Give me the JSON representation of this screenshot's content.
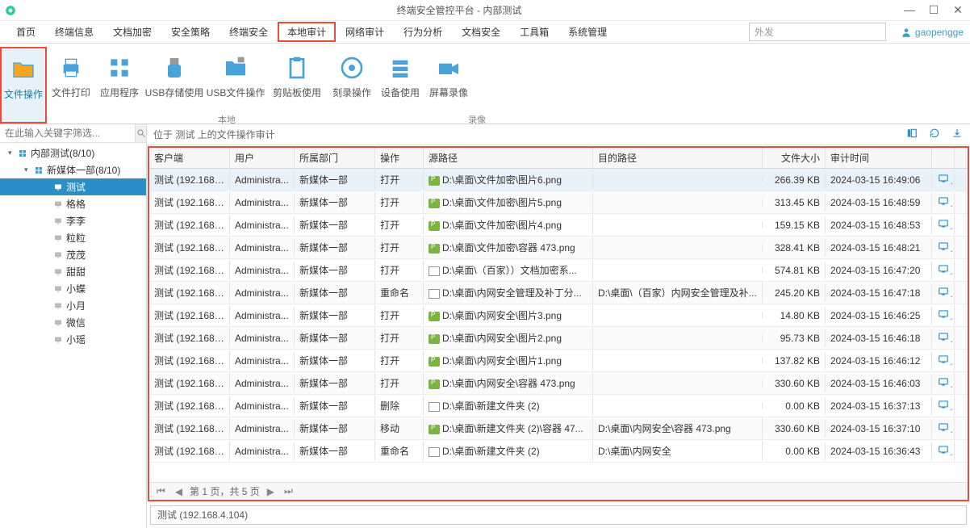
{
  "window": {
    "title": "终端安全管控平台 - 内部测试"
  },
  "menu": {
    "items": [
      "首页",
      "终端信息",
      "文档加密",
      "安全策略",
      "终端安全",
      "本地审计",
      "网络审计",
      "行为分析",
      "文档安全",
      "工具箱",
      "系统管理"
    ],
    "active_index": 5,
    "search_placeholder": "外发",
    "user": "gaopengge"
  },
  "ribbon": {
    "items": [
      {
        "label": "文件操作",
        "icon": "folder",
        "highlight": true
      },
      {
        "label": "文件打印",
        "icon": "printer"
      },
      {
        "label": "应用程序",
        "icon": "apps"
      },
      {
        "label": "USB存储使用",
        "icon": "usb",
        "wide": true
      },
      {
        "label": "USB文件操作",
        "icon": "usb-file",
        "wide": true
      },
      {
        "label": "剪贴板使用",
        "icon": "clipboard",
        "wide": true
      },
      {
        "label": "刻录操作",
        "icon": "disc"
      },
      {
        "label": "设备使用",
        "icon": "device"
      },
      {
        "label": "屏幕录像",
        "icon": "camera"
      }
    ],
    "group_local": "本地",
    "group_record": "录像"
  },
  "sidebar": {
    "search_placeholder": "在此输入关键字筛选...",
    "root": {
      "label": "内部测试(8/10)"
    },
    "group": {
      "label": "新媒体一部(8/10)"
    },
    "nodes": [
      {
        "label": "测试",
        "selected": true
      },
      {
        "label": "格格"
      },
      {
        "label": "李李"
      },
      {
        "label": "粒粒"
      },
      {
        "label": "茂茂"
      },
      {
        "label": "甜甜"
      },
      {
        "label": "小蝶"
      },
      {
        "label": "小月"
      },
      {
        "label": "微信"
      },
      {
        "label": "小瑶"
      }
    ]
  },
  "content": {
    "path_label": "位于 测试 上的文件操作审计",
    "columns": {
      "client": "客户端",
      "user": "用户",
      "dept": "所属部门",
      "op": "操作",
      "src": "源路径",
      "dst": "目的路径",
      "size": "文件大小",
      "time": "审计时间"
    },
    "rows": [
      {
        "client": "测试 (192.168.4...",
        "user": "Administra...",
        "dept": "新媒体一部",
        "op": "打开",
        "src": "D:\\桌面\\文件加密\\图片6.png",
        "src_type": "png",
        "dst": "",
        "size": "266.39 KB",
        "time": "2024-03-15 16:49:06",
        "hover": true
      },
      {
        "client": "测试 (192.168.4...",
        "user": "Administra...",
        "dept": "新媒体一部",
        "op": "打开",
        "src": "D:\\桌面\\文件加密\\图片5.png",
        "src_type": "png",
        "dst": "",
        "size": "313.45 KB",
        "time": "2024-03-15 16:48:59"
      },
      {
        "client": "测试 (192.168.4...",
        "user": "Administra...",
        "dept": "新媒体一部",
        "op": "打开",
        "src": "D:\\桌面\\文件加密\\图片4.png",
        "src_type": "png",
        "dst": "",
        "size": "159.15 KB",
        "time": "2024-03-15 16:48:53"
      },
      {
        "client": "测试 (192.168.4...",
        "user": "Administra...",
        "dept": "新媒体一部",
        "op": "打开",
        "src": "D:\\桌面\\文件加密\\容器 473.png",
        "src_type": "png",
        "dst": "",
        "size": "328.41 KB",
        "time": "2024-03-15 16:48:21"
      },
      {
        "client": "测试 (192.168.4...",
        "user": "Administra...",
        "dept": "新媒体一部",
        "op": "打开",
        "src": "D:\\桌面\\（百家））文档加密系...",
        "src_type": "doc",
        "dst": "",
        "size": "574.81 KB",
        "time": "2024-03-15 16:47:20"
      },
      {
        "client": "测试 (192.168.4...",
        "user": "Administra...",
        "dept": "新媒体一部",
        "op": "重命名",
        "src": "D:\\桌面\\内网安全管理及补丁分...",
        "src_type": "doc",
        "dst": "D:\\桌面\\（百家）内网安全管理及补...",
        "size": "245.20 KB",
        "time": "2024-03-15 16:47:18"
      },
      {
        "client": "测试 (192.168.4...",
        "user": "Administra...",
        "dept": "新媒体一部",
        "op": "打开",
        "src": "D:\\桌面\\内网安全\\图片3.png",
        "src_type": "png",
        "dst": "",
        "size": "14.80 KB",
        "time": "2024-03-15 16:46:25"
      },
      {
        "client": "测试 (192.168.4...",
        "user": "Administra...",
        "dept": "新媒体一部",
        "op": "打开",
        "src": "D:\\桌面\\内网安全\\图片2.png",
        "src_type": "png",
        "dst": "",
        "size": "95.73 KB",
        "time": "2024-03-15 16:46:18"
      },
      {
        "client": "测试 (192.168.4...",
        "user": "Administra...",
        "dept": "新媒体一部",
        "op": "打开",
        "src": "D:\\桌面\\内网安全\\图片1.png",
        "src_type": "png",
        "dst": "",
        "size": "137.82 KB",
        "time": "2024-03-15 16:46:12"
      },
      {
        "client": "测试 (192.168.4...",
        "user": "Administra...",
        "dept": "新媒体一部",
        "op": "打开",
        "src": "D:\\桌面\\内网安全\\容器 473.png",
        "src_type": "png",
        "dst": "",
        "size": "330.60 KB",
        "time": "2024-03-15 16:46:03"
      },
      {
        "client": "测试 (192.168.4...",
        "user": "Administra...",
        "dept": "新媒体一部",
        "op": "删除",
        "src": "D:\\桌面\\新建文件夹 (2)",
        "src_type": "doc",
        "dst": "",
        "size": "0.00 KB",
        "time": "2024-03-15 16:37:13"
      },
      {
        "client": "测试 (192.168.4...",
        "user": "Administra...",
        "dept": "新媒体一部",
        "op": "移动",
        "src": "D:\\桌面\\新建文件夹 (2)\\容器 47...",
        "src_type": "png",
        "dst": "D:\\桌面\\内网安全\\容器 473.png",
        "size": "330.60 KB",
        "time": "2024-03-15 16:37:10"
      },
      {
        "client": "测试 (192.168.4...",
        "user": "Administra...",
        "dept": "新媒体一部",
        "op": "重命名",
        "src": "D:\\桌面\\新建文件夹 (2)",
        "src_type": "doc",
        "dst": "D:\\桌面\\内网安全",
        "size": "0.00 KB",
        "time": "2024-03-15 16:36:43"
      }
    ],
    "pager": "第 1 页，共 5 页",
    "status": "测试 (192.168.4.104)"
  }
}
